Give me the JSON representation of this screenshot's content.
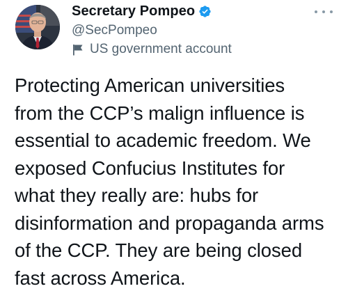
{
  "tweet": {
    "author": {
      "display_name": "Secretary Pompeo",
      "handle": "@SecPompeo",
      "label": "US government account",
      "verified": true
    },
    "text_lines": [
      "Protecting American universities",
      "from the CCP’s malign influence is",
      "essential to academic freedom. We",
      "exposed Confucius Institutes for",
      "what they really are: hubs for",
      "disinformation and propaganda arms",
      "of the CCP. They are being closed",
      "fast across America."
    ]
  },
  "icons": {
    "verified": "verified-badge-icon",
    "label": "flag-icon",
    "more": "more-options-icon"
  },
  "colors": {
    "verified_blue": "#1d9bf0",
    "secondary_text": "#536471",
    "primary_text": "#0f1419",
    "dots": "#8899a6"
  }
}
